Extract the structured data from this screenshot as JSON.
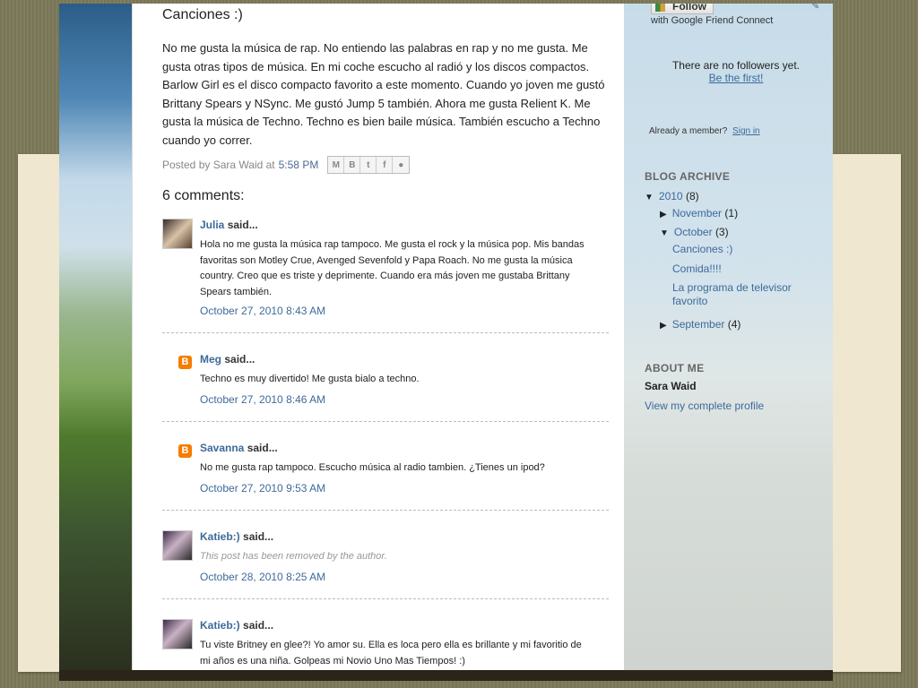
{
  "post": {
    "title": "Canciones :)",
    "body": "No me gusta la música de rap. No entiendo las palabras en rap y no me gusta. Me gusta otras tipos de música. En mi coche escucho al radió y los discos compactos. Barlow Girl es el disco compacto favorito a este momento. Cuando yo joven me gustó Brittany Spears y NSync. Me gustó Jump 5 también. Ahora me gusta Relient K. Me gusta la música de Techno. Techno es bien baile música. También escucho a Techno cuando yo correr.",
    "posted_by": "Posted by Sara Waid at",
    "time": "5:58 PM",
    "share_icons": [
      "email-icon",
      "blog-icon",
      "twitter-icon",
      "facebook-icon",
      "buzz-icon"
    ]
  },
  "comments_title": "6 comments:",
  "said": "said...",
  "comments": [
    {
      "author": "Julia",
      "avatar": "photo",
      "text": "Hola no me gusta la música rap tampoco. Me gusta el rock y la música pop. Mis bandas favoritas son Motley Crue, Avenged Sevenfold y Papa Roach. No me gusta la música country. Creo que es triste y deprimente. Cuando era más joven me gustaba Brittany Spears también.",
      "date": "October 27, 2010 8:43 AM"
    },
    {
      "author": "Meg",
      "avatar": "blogger-icon",
      "text": "Techno es muy divertido! Me gusta bialo a techno.",
      "date": "October 27, 2010 8:46 AM"
    },
    {
      "author": "Savanna",
      "avatar": "blogger-icon",
      "text": "No me gusta rap tampoco. Escucho música al radio tambien. ¿Tienes un ipod?",
      "date": "October 27, 2010 9:53 AM"
    },
    {
      "author": "Katieb:)",
      "avatar": "photo",
      "text": "This post has been removed by the author.",
      "date": "October 28, 2010 8:25 AM"
    },
    {
      "author": "Katieb:)",
      "avatar": "photo",
      "text": "Tu viste Britney en glee?! Yo amor su. Ella es loca pero ella es brillante y mi favoritio de mi años es una niña. Golpeas mi Novio Uno Mas Tiempos! :)",
      "date": ""
    }
  ],
  "sidebar": {
    "follow_label": "Follow",
    "with_gfc": "with Google Friend Connect",
    "no_followers": "There are no followers yet.",
    "be_first": "Be the first!",
    "already_member": "Already a member?",
    "sign_in": "Sign in",
    "archive_heading": "BLOG ARCHIVE",
    "year": {
      "label": "2010",
      "count": "(8)"
    },
    "months": [
      {
        "label": "November",
        "count": "(1)"
      },
      {
        "label": "October",
        "count": "(3)"
      },
      {
        "label": "September",
        "count": "(4)"
      }
    ],
    "october_posts": [
      "Canciones :)",
      "Comida!!!!",
      "La programa de televisor favorito"
    ],
    "about_heading": "ABOUT ME",
    "about_name": "Sara Waid",
    "view_profile": "View my complete profile"
  },
  "colors": {
    "link": "#3d6a9a",
    "blogger_orange": "#f57d00"
  }
}
